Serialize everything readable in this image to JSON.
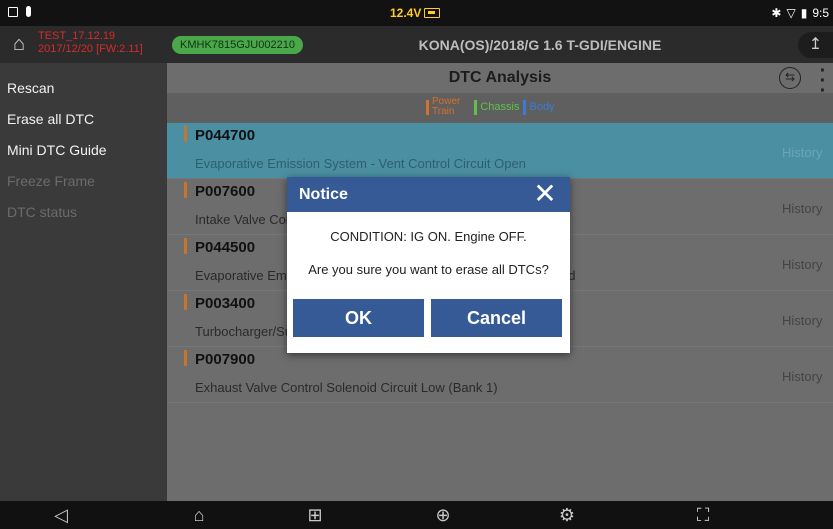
{
  "status_bar": {
    "voltage": "12.4V",
    "time": "9:5"
  },
  "header": {
    "test_info_line1": "TEST_17.12.19",
    "test_info_line2": "2017/12/20 [FW:2.11]",
    "vin": "KMHK7815GJU002210",
    "vehicle": "KONA(OS)/2018/G 1.6 T-GDI/ENGINE"
  },
  "sidebar": {
    "items": [
      {
        "label": "Rescan",
        "enabled": true
      },
      {
        "label": "Erase all DTC",
        "enabled": true
      },
      {
        "label": "Mini DTC Guide",
        "enabled": true
      },
      {
        "label": "Freeze Frame",
        "enabled": false
      },
      {
        "label": "DTC status",
        "enabled": false
      }
    ]
  },
  "main": {
    "title": "DTC Analysis",
    "legend": {
      "powertrain_line1": "Power",
      "powertrain_line2": "Train",
      "chassis": "Chassis",
      "body": "Body"
    },
    "colors": {
      "powertrain": "#d6702a",
      "chassis": "#5fc14a",
      "body": "#3b7bd8",
      "selected_row": "#4b8fa3",
      "accent": "#355a95"
    },
    "dtc_rows": [
      {
        "code": "P044700",
        "desc": "Evaporative Emission System - Vent Control Circuit Open",
        "status": "History",
        "selected": true
      },
      {
        "code": "P007600",
        "desc": "Intake Valve Control Solenoid Circuit Low (Bank 1)",
        "status": "History",
        "selected": false
      },
      {
        "code": "P044500",
        "desc": "Evaporative Emission System Purge Control Valve Circuit Shorted",
        "status": "History",
        "selected": false
      },
      {
        "code": "P003400",
        "desc": "Turbocharger/Supercharger Bypass Valve Control Circuit Low",
        "status": "History",
        "selected": false
      },
      {
        "code": "P007900",
        "desc": "Exhaust Valve Control Solenoid Circuit Low (Bank 1)",
        "status": "History",
        "selected": false
      }
    ]
  },
  "dialog": {
    "title": "Notice",
    "message_line1": "CONDITION: IG ON. Engine OFF.",
    "message_line2": "Are you sure you want to erase all DTCs?",
    "ok_label": "OK",
    "cancel_label": "Cancel"
  },
  "navbar": {
    "icons": [
      "back-icon",
      "home-icon",
      "apps-grid-icon",
      "globe-icon",
      "settings-gear-icon",
      "screenshot-icon"
    ]
  }
}
